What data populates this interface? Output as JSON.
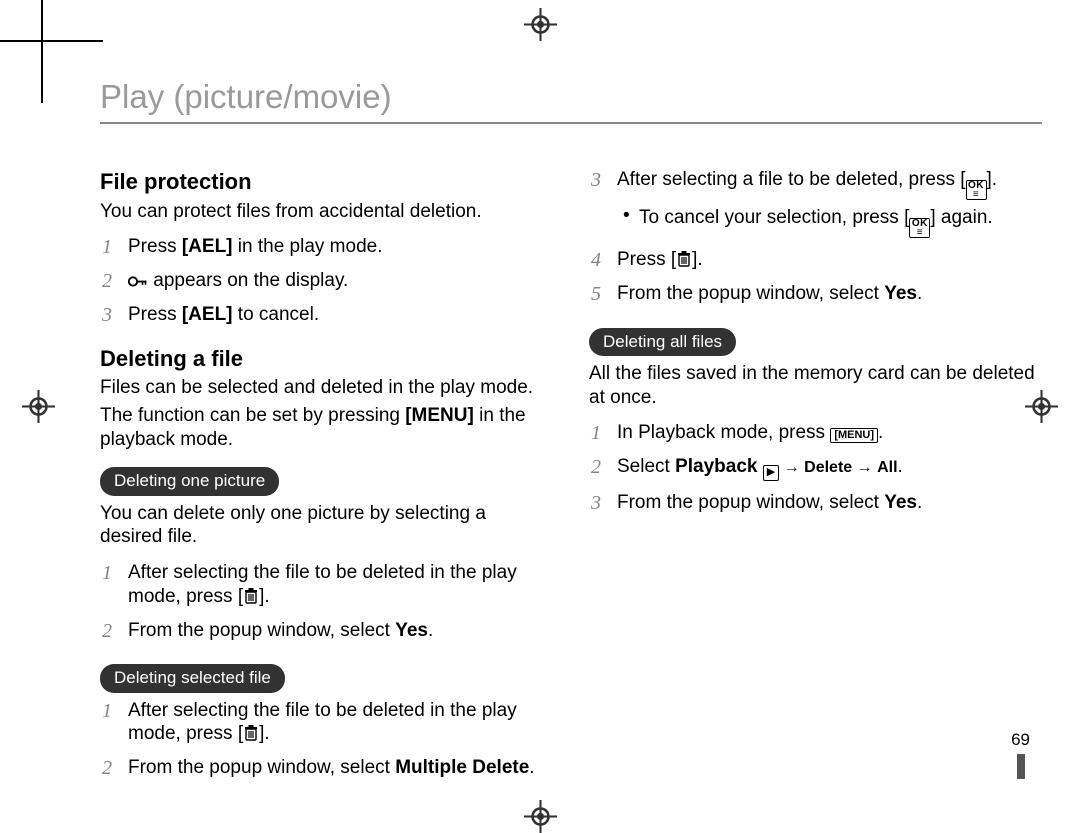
{
  "title": "Play (picture/movie)",
  "page_number": "69",
  "left": {
    "h1": "File protection",
    "p1": "You can protect files from accidental deletion.",
    "s1_1a": "Press ",
    "s1_1b": "[AEL]",
    "s1_1c": " in the play mode.",
    "s1_2a": " appears on the display.",
    "s1_3a": "Press ",
    "s1_3b": "[AEL]",
    "s1_3c": " to cancel.",
    "h2": "Deleting a file",
    "p2": "Files can be selected and deleted in the play mode.",
    "p3a": "The function can be set by pressing ",
    "p3b": "[MENU]",
    "p3c": " in the playback mode.",
    "pill1": "Deleting one picture",
    "p4": "You can delete only one picture by selecting a desired file.",
    "s2_1a": "After selecting the file to be deleted in the play mode, press [",
    "s2_1b": "].",
    "s2_2a": "From the popup window, select ",
    "s2_2b": "Yes",
    "s2_2c": ".",
    "pill2": "Deleting selected file",
    "s3_1a": "After selecting the file to be deleted in the play mode, press [",
    "s3_1b": "].",
    "s3_2a": "From the popup window, select ",
    "s3_2b": "Multiple Delete",
    "s3_2c": "."
  },
  "right": {
    "r3a": "After selecting a file to be deleted, press [",
    "r3b": "].",
    "r3sub_a": "To cancel your selection, press [",
    "r3sub_b": "] again.",
    "r4a": "Press [",
    "r4b": "].",
    "r5a": "From the popup window, select ",
    "r5b": "Yes",
    "r5c": ".",
    "pill3": "Deleting all files",
    "p5": "All the files saved in the memory card can be deleted at once.",
    "s4_1a": "In Playback mode, press ",
    "s4_1b": "[MENU]",
    "s4_1c": ".",
    "s4_2a": "Select ",
    "s4_2b": "Playback",
    "s4_2c": " → ",
    "s4_2d": "Delete",
    "s4_2e": " → ",
    "s4_2f": "All",
    "s4_2g": ".",
    "s4_3a": "From the popup window, select ",
    "s4_3b": "Yes",
    "s4_3c": "."
  },
  "icons": {
    "key": "key-icon",
    "trash": "trash-icon",
    "ok": "ok-menu-icon",
    "menu": "menu-icon",
    "play": "playback-icon",
    "registration": "registration-mark-icon"
  }
}
